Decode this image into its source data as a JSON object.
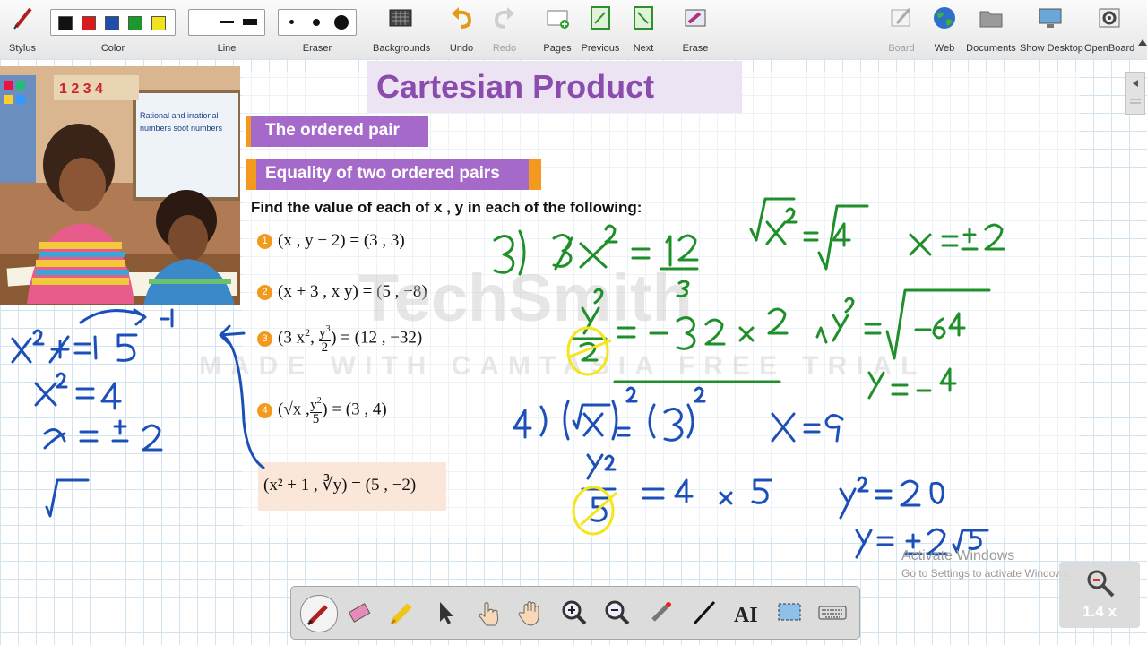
{
  "toolbar": {
    "stylus": "Stylus",
    "color": "Color",
    "line": "Line",
    "eraser": "Eraser",
    "backgrounds": "Backgrounds",
    "undo": "Undo",
    "redo": "Redo",
    "pages": "Pages",
    "previous": "Previous",
    "next": "Next",
    "erase": "Erase",
    "board": "Board",
    "web": "Web",
    "documents": "Documents",
    "show_desktop": "Show Desktop",
    "openboard": "OpenBoard",
    "colors": [
      "#111111",
      "#d81a1a",
      "#1f4fa8",
      "#1a9a2a",
      "#f2e21a"
    ]
  },
  "slide": {
    "title": "Cartesian Product",
    "section1": "The ordered pair",
    "section2": "Equality of two ordered pairs",
    "instructions": "Find the value of each of x , y in each of the following:",
    "problems": {
      "n1": "1",
      "p1": "(x , y − 2) = (3 , 3)",
      "n2": "2",
      "p2": "(x + 3 , x y) = (5 , −8)",
      "n3": "3",
      "p3a": "(3 x",
      "p3b": ", ",
      "p3c": ") = (12 , −32)",
      "n4": "4",
      "p4a": "(√x ,",
      "p4b": ") = (3 , 4)",
      "p5": "(x² + 1 , ∛y) = (5 , −2)"
    },
    "photo_board_text": "Rational and irrational numbers soot numbers",
    "accent_color": "#8a4cad",
    "orange_color": "#f39a1e"
  },
  "watermark": {
    "line1": "TechSmith",
    "line2": "MADE WITH CAMTASIA FREE TRIAL"
  },
  "activate_windows": {
    "title": "Activate Windows",
    "subtitle": "Go to Settings to activate Windows."
  },
  "zoom": {
    "level": "1.4 x"
  },
  "ink_colors": {
    "blue": "#1c50b8",
    "green": "#1f8f2a",
    "highlight": "#f3e61c"
  }
}
